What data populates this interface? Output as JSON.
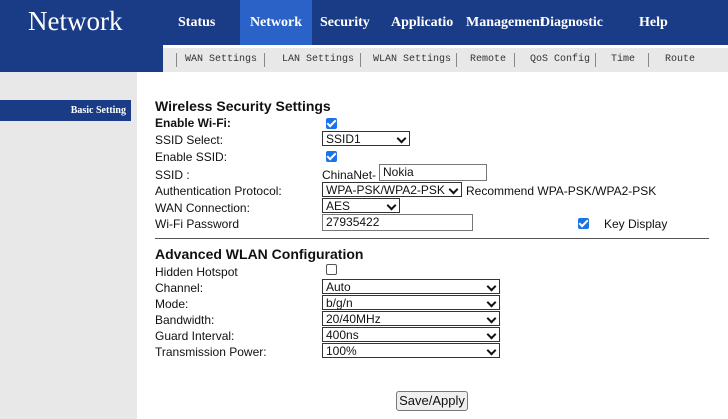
{
  "header": {
    "brand": "Network",
    "menu": [
      "Status",
      "Network",
      "Security",
      "Applicatio",
      "Management",
      "Diagnostic",
      "Help"
    ],
    "submenu": [
      "WAN Settings",
      "LAN Settings",
      "WLAN Settings",
      "Remote",
      "QoS Config",
      "Time",
      "Route"
    ]
  },
  "sidebar": {
    "items": [
      "Basic Setting"
    ]
  },
  "wireless": {
    "title": "Wireless Security Settings",
    "enable_wifi_label": "Enable Wi-Fi:",
    "ssid_select_label": "SSID Select:",
    "ssid_select_value": "SSID1",
    "enable_ssid_label": "Enable SSID:",
    "ssid_label": "SSID :",
    "ssid_prefix": "ChinaNet-",
    "ssid_value": "Nokia",
    "auth_label": "Authentication Protocol:",
    "auth_value": "WPA-PSK/WPA2-PSK",
    "auth_recommend": "Recommend WPA-PSK/WPA2-PSK",
    "wan_conn_label": "WAN Connection:",
    "wan_conn_value": "AES",
    "password_label": "Wi-Fi Password",
    "password_value": "27935422",
    "key_display_label": "Key Display"
  },
  "advanced": {
    "title": "Advanced WLAN Configuration",
    "hidden_label": "Hidden Hotspot",
    "channel_label": "Channel:",
    "channel_value": "Auto",
    "mode_label": "Mode:",
    "mode_value": "b/g/n",
    "bandwidth_label": "Bandwidth:",
    "bandwidth_value": "20/40MHz",
    "guard_label": "Guard Interval:",
    "guard_value": "400ns",
    "power_label": "Transmission Power:",
    "power_value": "100%"
  },
  "actions": {
    "save_label": "Save/Apply"
  },
  "colors": {
    "header_bg": "#1a3b85",
    "active_tab": "#2b62c7",
    "checkbox": "#1a73e8",
    "sidebar_bg": "#e8e8e8"
  }
}
